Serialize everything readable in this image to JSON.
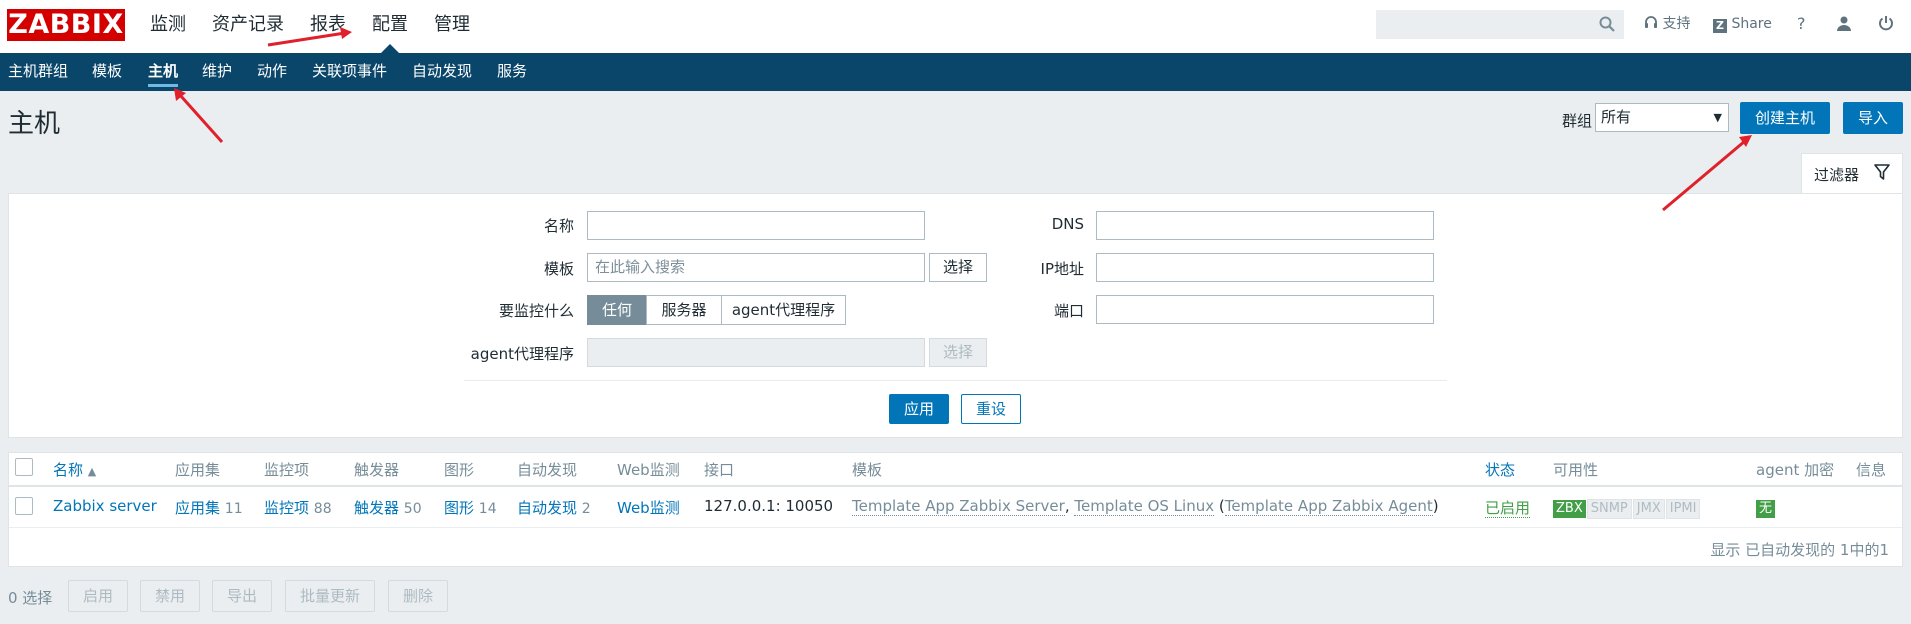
{
  "brand": {
    "logo": "ZABBIX"
  },
  "main_nav": [
    "监测",
    "资产记录",
    "报表",
    "配置",
    "管理"
  ],
  "top_right": {
    "support": "支持",
    "share": "Share",
    "help": "?"
  },
  "sub_nav": [
    "主机群组",
    "模板",
    "主机",
    "维护",
    "动作",
    "关联项事件",
    "自动发现",
    "服务"
  ],
  "page": {
    "title": "主机",
    "group_label": "群组",
    "group_value": "所有",
    "create_button": "创建主机",
    "import_button": "导入",
    "filter_tab": "过滤器"
  },
  "filter": {
    "name_label": "名称",
    "template_label": "模板",
    "template_placeholder": "在此输入搜索",
    "select_button": "选择",
    "monitored_label": "要监控什么",
    "monitored_options": [
      "任何",
      "服务器",
      "agent代理程序"
    ],
    "proxy_label": "agent代理程序",
    "proxy_select_button": "选择",
    "dns_label": "DNS",
    "ip_label": "IP地址",
    "port_label": "端口",
    "apply_button": "应用",
    "reset_button": "重设"
  },
  "table": {
    "headers": {
      "name": "名称",
      "sort_icon": "▲",
      "applications": "应用集",
      "items": "监控项",
      "triggers": "触发器",
      "graphs": "图形",
      "discovery": "自动发现",
      "web": "Web监测",
      "interface": "接口",
      "templates": "模板",
      "status": "状态",
      "availability": "可用性",
      "encryption": "agent 加密",
      "info": "信息"
    },
    "rows": [
      {
        "name": "Zabbix server",
        "applications": "应用集",
        "applications_count": "11",
        "items": "监控项",
        "items_count": "88",
        "triggers": "触发器",
        "triggers_count": "50",
        "graphs": "图形",
        "graphs_count": "14",
        "discovery": "自动发现",
        "discovery_count": "2",
        "web": "Web监测",
        "interface": "127.0.0.1: 10050",
        "template_1": "Template App Zabbix Server",
        "template_2": "Template OS Linux",
        "template_3": "Template App Zabbix Agent",
        "status": "已启用",
        "availability": [
          "ZBX",
          "SNMP",
          "JMX",
          "IPMI"
        ],
        "encryption": "无"
      }
    ],
    "footer": "显示 已自动发现的 1中的1"
  },
  "mass_actions": {
    "selected": "0 选择",
    "buttons": [
      "启用",
      "禁用",
      "导出",
      "批量更新",
      "删除"
    ]
  },
  "colors": {
    "brand_red": "#d40000",
    "nav_blue": "#0a466a",
    "primary_blue": "#0275b8",
    "enabled_green": "#429e47",
    "annotation_red": "#e0202a"
  }
}
